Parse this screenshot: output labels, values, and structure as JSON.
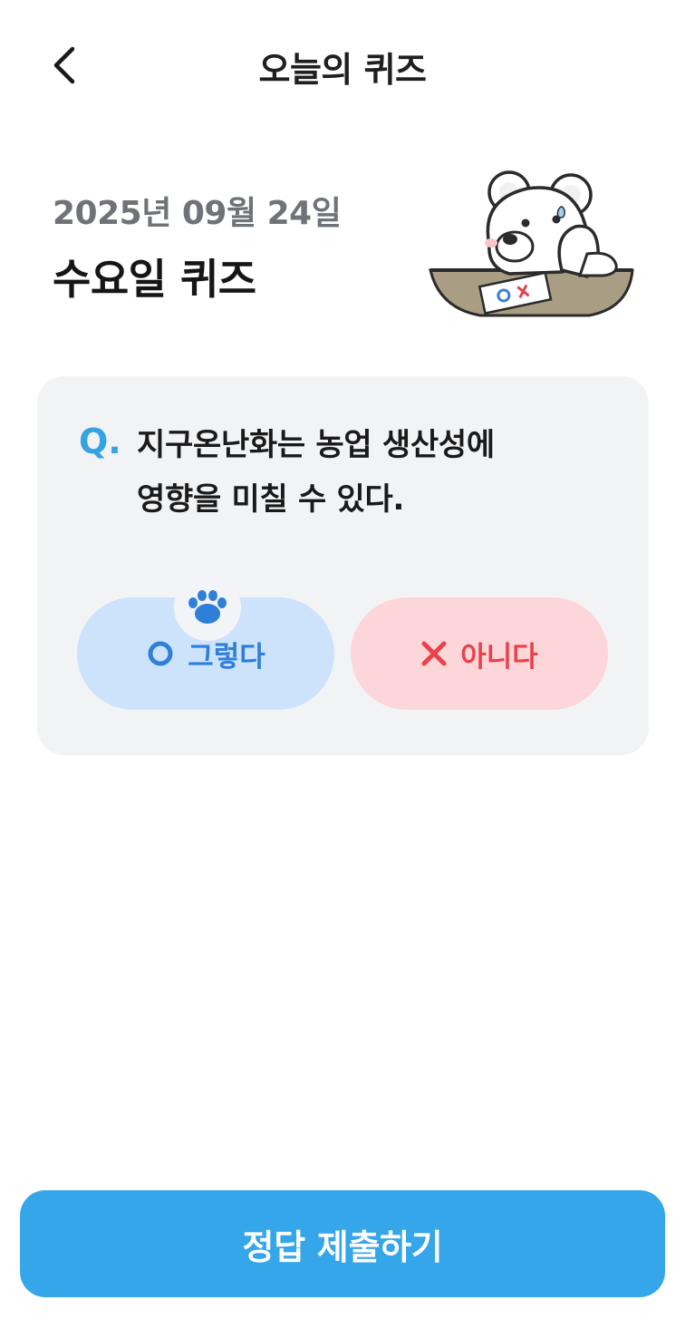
{
  "header": {
    "title": "오늘의 퀴즈",
    "back_icon": "chevron-left-icon"
  },
  "quiz": {
    "date": "2025년 09월 24일",
    "day_title": "수요일 퀴즈",
    "mascot_icon": "bear-mascot-icon",
    "question_prefix": "Q.",
    "question_lines": [
      "지구온난화는 농업 생산성에",
      "영향을 미칠 수 있다."
    ],
    "answers": {
      "yes_label": "그렇다",
      "no_label": "아니다",
      "yes_icon": "circle-o-icon",
      "no_icon": "x-icon",
      "selected_indicator_icon": "paw-icon"
    }
  },
  "footer": {
    "submit_label": "정답 제출하기"
  },
  "colors": {
    "accent": "#35a6e9",
    "yes_bg": "#cce3fb",
    "yes_text": "#2f7fd8",
    "no_bg": "#fdd6d9",
    "no_text": "#e8424b",
    "card_bg": "#f2f3f5"
  }
}
